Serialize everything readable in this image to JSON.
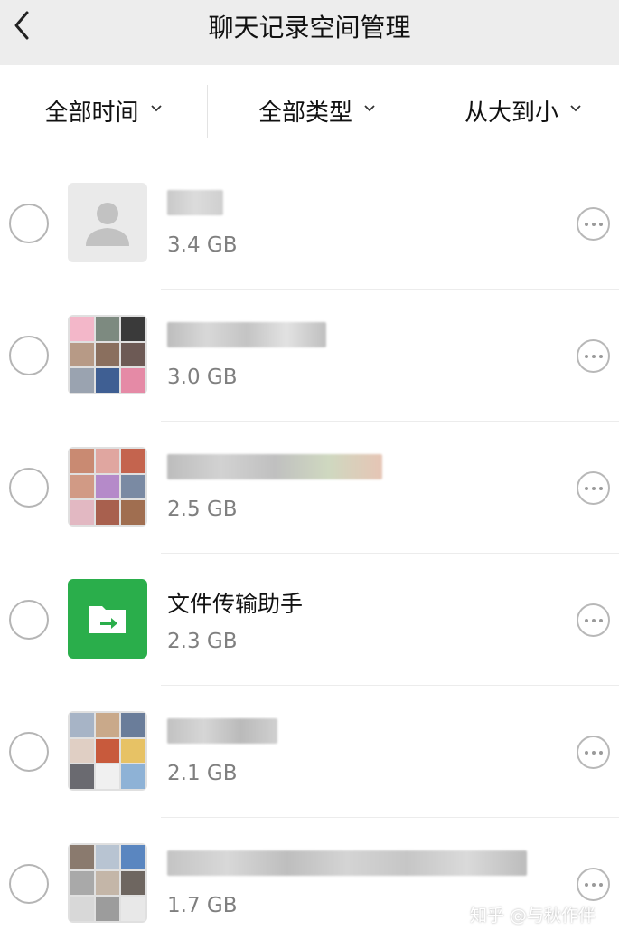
{
  "navbar": {
    "title": "聊天记录空间管理"
  },
  "filters": [
    {
      "label": "全部时间"
    },
    {
      "label": "全部类型"
    },
    {
      "label": "从大到小"
    }
  ],
  "chats": [
    {
      "name": "",
      "size": "3.4 GB",
      "avatar": "default-contact"
    },
    {
      "name": "",
      "size": "3.0 GB",
      "avatar": "group-grid"
    },
    {
      "name": "",
      "size": "2.5 GB",
      "avatar": "group-grid"
    },
    {
      "name": "文件传输助手",
      "size": "2.3 GB",
      "avatar": "file-transfer-icon"
    },
    {
      "name": "",
      "size": "2.1 GB",
      "avatar": "group-grid"
    },
    {
      "name": "",
      "size": "1.7 GB",
      "avatar": "group-grid"
    }
  ],
  "colors": {
    "navbar_bg": "#ededed",
    "file_transfer_green": "#2aae4b",
    "secondary_text": "#7f7f7f"
  },
  "watermark": "知乎 @与秋作伴"
}
